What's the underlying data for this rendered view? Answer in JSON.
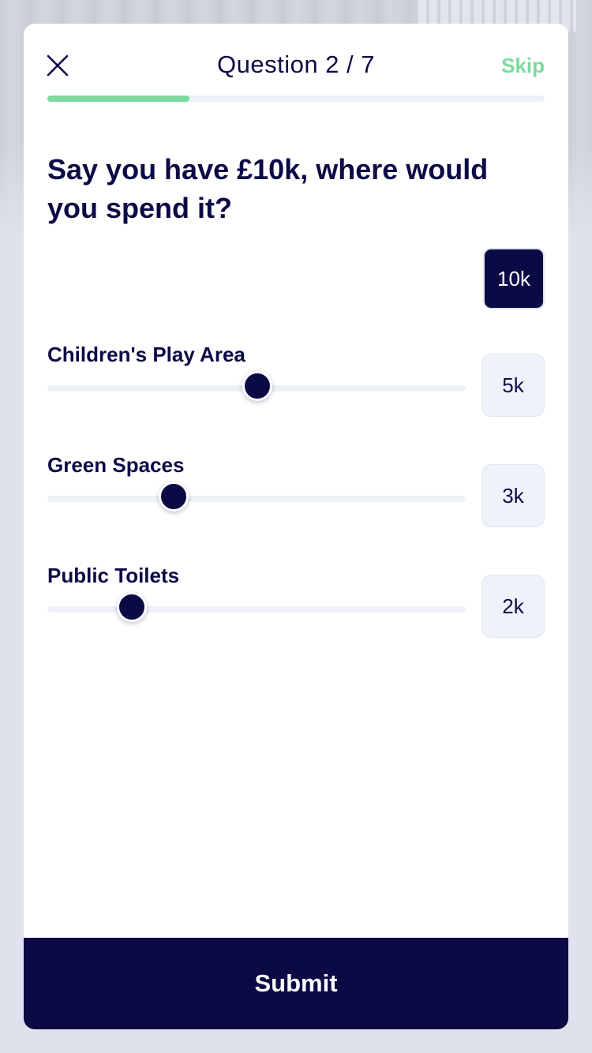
{
  "header": {
    "close_icon": "close-icon",
    "title": "Question 2 / 7",
    "skip_label": "Skip",
    "progress_fraction": 0.2857
  },
  "question": {
    "text": "Say you have £10k, where would you spend it?",
    "total_label": "10k"
  },
  "options": [
    {
      "label": "Children's Play Area",
      "value_label": "5k",
      "value": 5
    },
    {
      "label": "Green Spaces",
      "value_label": "3k",
      "value": 3
    },
    {
      "label": "Public Toilets",
      "value_label": "2k",
      "value": 2
    }
  ],
  "slider_max": 10,
  "submit_label": "Submit",
  "colors": {
    "primary": "#0c0a45",
    "accent": "#7ed9a0",
    "track": "#eef1f7"
  }
}
